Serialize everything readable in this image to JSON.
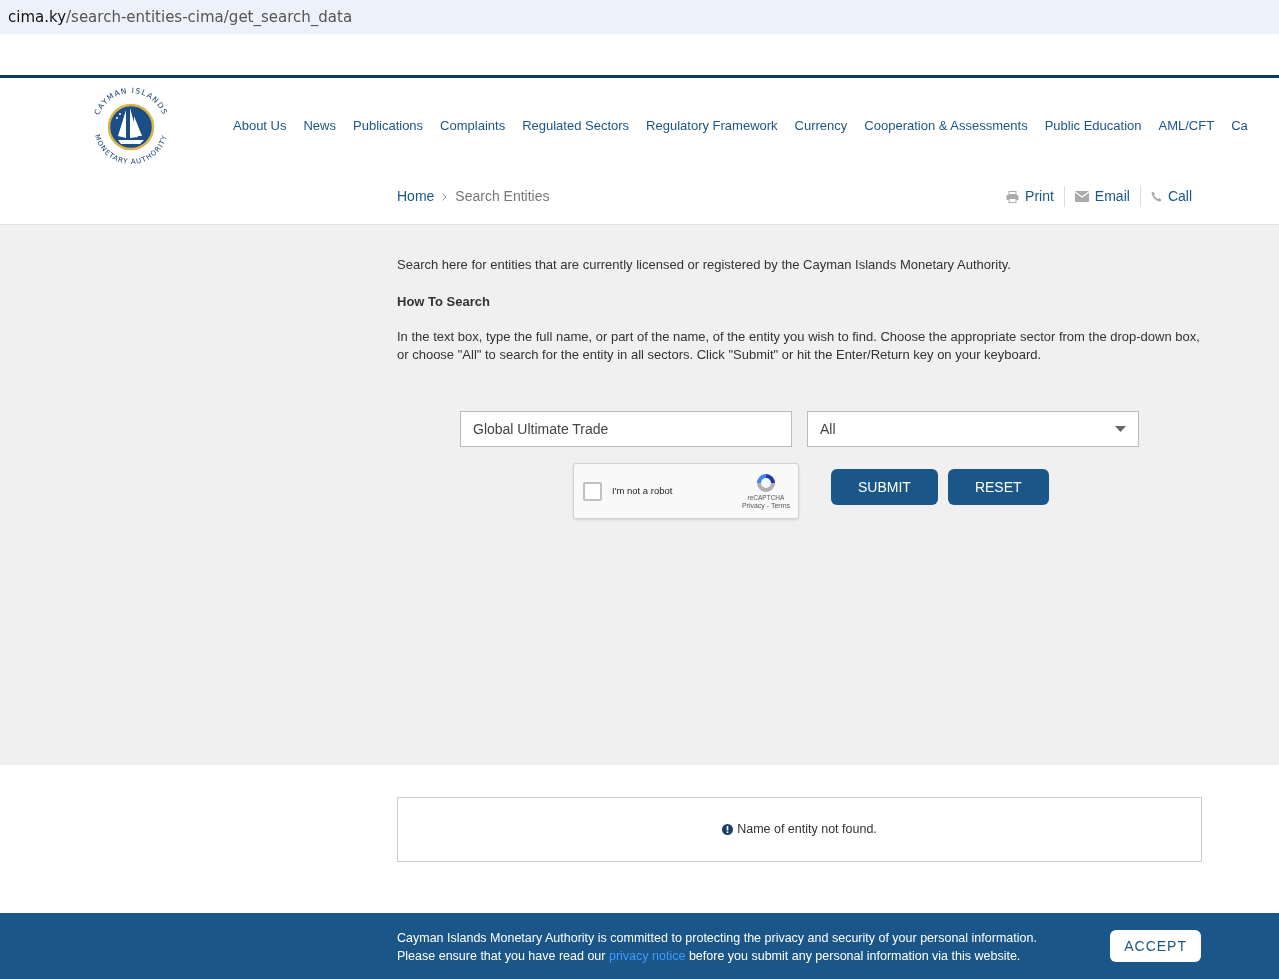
{
  "address_bar": {
    "url_host": "cima.ky",
    "url_path": "/search-entities-cima/get_search_data"
  },
  "logo": {
    "top_text": "CAYMAN ISLANDS",
    "bottom_text": "MONETARY AUTHORITY"
  },
  "nav": [
    "About Us",
    "News",
    "Publications",
    "Complaints",
    "Regulated Sectors",
    "Regulatory Framework",
    "Currency",
    "Cooperation & Assessments",
    "Public Education",
    "AML/CFT",
    "Ca"
  ],
  "breadcrumb": [
    "Home",
    "Search Entities"
  ],
  "actions": [
    {
      "kind": "print",
      "label": "Print"
    },
    {
      "kind": "email",
      "label": "Email"
    },
    {
      "kind": "call",
      "label": "Call"
    }
  ],
  "intro": "Search here for entities that are currently licensed or registered by the Cayman Islands Monetary Authority.",
  "how_to_title": "How To Search",
  "how_to_text": "In the text box, type the full name, or part of the name, of the entity you wish to find. Choose the appropriate sector from the drop-down box, or choose \"All\" to search for the entity in all sectors. Click \"Submit\" or hit the Enter/Return key on your keyboard.",
  "search_field": {
    "value": "Global Ultimate Trade"
  },
  "sector_select": {
    "value": "All"
  },
  "captcha": {
    "label": "I'm not a robot",
    "checked": false,
    "brand": "reCAPTCHA",
    "links": "Privacy - Terms"
  },
  "buttons": [
    "SUBMIT",
    "RESET"
  ],
  "result_message": "Name of entity not found.",
  "cookie_banner": {
    "line1": "Cayman Islands Monetary Authority is committed to protecting the privacy and security of your personal information.",
    "line2_before": "Please ensure that you have read our",
    "link": "privacy notice",
    "line2_after": "before you submit any personal information via this website.",
    "button": "ACCEPT"
  }
}
